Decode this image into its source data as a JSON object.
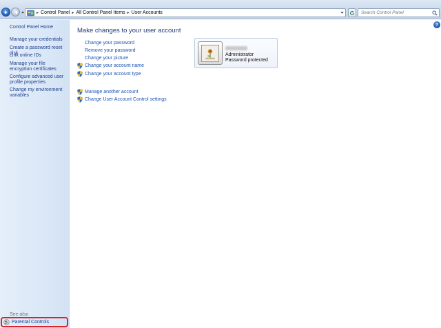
{
  "address_bar": {
    "breadcrumbs": [
      "Control Panel",
      "All Control Panel Items",
      "User Accounts"
    ],
    "separator": "▸"
  },
  "search": {
    "placeholder": "Search Control Panel"
  },
  "left_pane": {
    "home": "Control Panel Home",
    "tasks": [
      "Manage your credentials",
      "Create a password reset disk",
      "Link online IDs",
      "Manage your file encryption certificates",
      "Configure advanced user profile properties",
      "Change my environment variables"
    ],
    "see_also_label": "See also",
    "parental_controls": "Parental Controls"
  },
  "main": {
    "title": "Make changes to your user account",
    "links": [
      "Change your password",
      "Remove your password",
      "Change your picture"
    ],
    "shield_links": [
      "Change your account name",
      "Change your account type"
    ],
    "other_shield_links": [
      "Manage another account",
      "Change User Account Control settings"
    ]
  },
  "account": {
    "role": "Administrator",
    "status": "Password protected"
  },
  "help": {
    "label": "?"
  },
  "colors": {
    "link": "#1c54b3",
    "heading": "#1e3a78",
    "highlight": "#d9232f",
    "pane_bg": "#dbe8f7"
  },
  "icons": [
    "back-arrow-icon",
    "forward-arrow-icon",
    "control-panel-icon",
    "refresh-icon",
    "search-icon",
    "uac-shield-icon",
    "parental-controls-icon",
    "help-icon"
  ]
}
